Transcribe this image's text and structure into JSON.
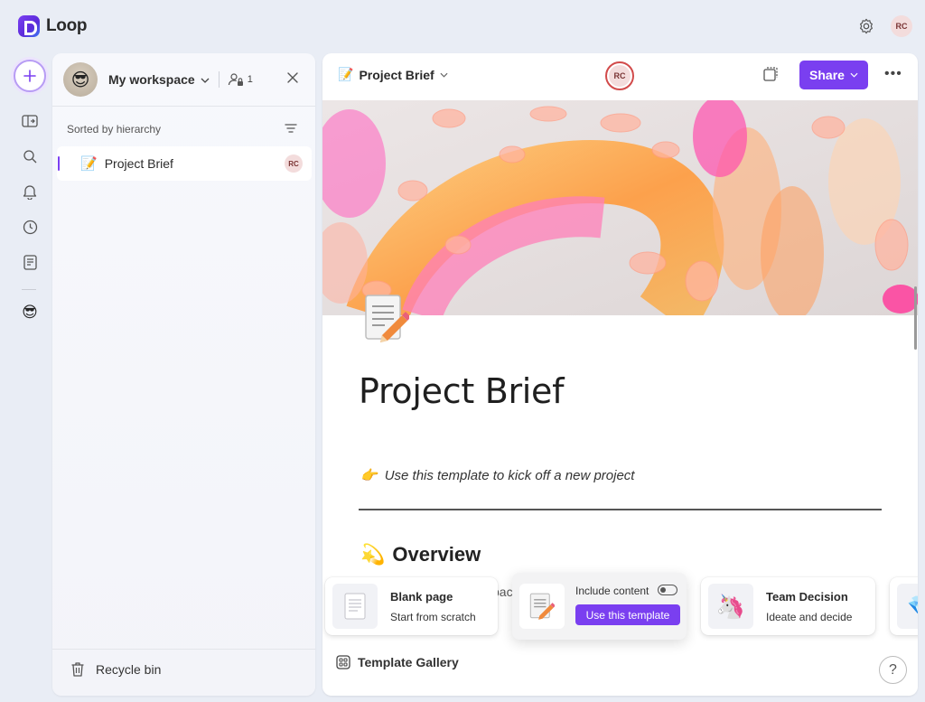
{
  "app": {
    "name": "Loop",
    "user_initials": "RC"
  },
  "workspace": {
    "name": "My workspace",
    "member_count": "1",
    "sort_label": "Sorted by hierarchy",
    "pages": [
      {
        "label": "Project Brief",
        "owner_initials": "RC"
      }
    ],
    "recycle_bin": "Recycle bin"
  },
  "page": {
    "title_bar": "Project Brief",
    "collaborator_initials": "RC",
    "share_label": "Share",
    "title": "Project Brief",
    "subtitle": "Use this template to kick off a new project",
    "section_heading": "Overview",
    "partial_text": "pac                              s a"
  },
  "templates": {
    "cards": [
      {
        "title": "Blank page",
        "subtitle": "Start from scratch"
      },
      {
        "include_label": "Include content",
        "include_enabled": false,
        "button_label": "Use this template"
      },
      {
        "title": "Team Decision",
        "subtitle": "Ideate and decide"
      }
    ],
    "gallery_label": "Template Gallery",
    "help_label": "?"
  },
  "colors": {
    "accent": "#7a3ff0",
    "avatar_bg": "#f3dcdc",
    "avatar_ring": "#d24b4b"
  }
}
